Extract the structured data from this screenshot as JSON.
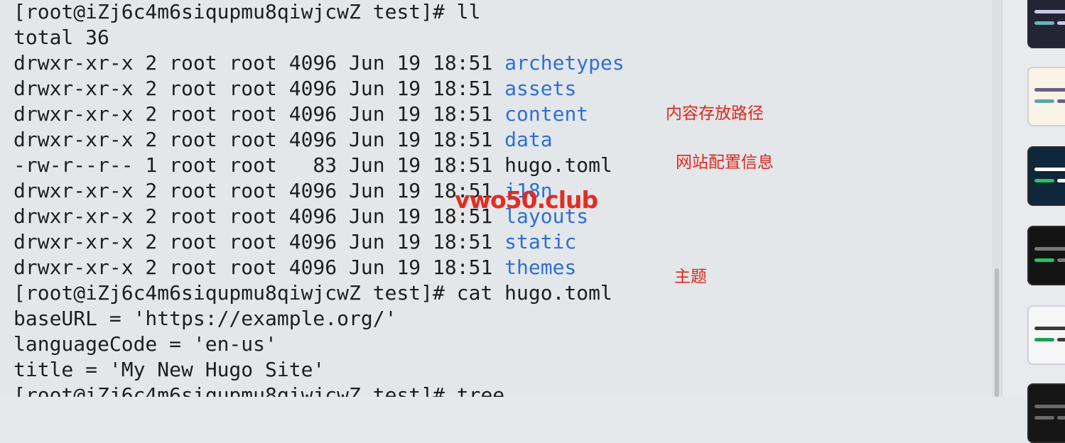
{
  "terminal": {
    "lines": [
      [
        {
          "t": "[root@iZj6c4m6siqupmu8qiwjcwZ test]# ll"
        }
      ],
      [
        {
          "t": "total 36"
        }
      ],
      [
        {
          "t": "drwxr-xr-x 2 root root 4096 Jun 19 18:51 "
        },
        {
          "t": "archetypes",
          "dir": true
        }
      ],
      [
        {
          "t": "drwxr-xr-x 2 root root 4096 Jun 19 18:51 "
        },
        {
          "t": "assets",
          "dir": true
        }
      ],
      [
        {
          "t": "drwxr-xr-x 2 root root 4096 Jun 19 18:51 "
        },
        {
          "t": "content",
          "dir": true
        }
      ],
      [
        {
          "t": "drwxr-xr-x 2 root root 4096 Jun 19 18:51 "
        },
        {
          "t": "data",
          "dir": true
        }
      ],
      [
        {
          "t": "-rw-r--r-- 1 root root   83 Jun 19 18:51 hugo.toml"
        }
      ],
      [
        {
          "t": "drwxr-xr-x 2 root root 4096 Jun 19 18:51 "
        },
        {
          "t": "i18n",
          "dir": true
        }
      ],
      [
        {
          "t": "drwxr-xr-x 2 root root 4096 Jun 19 18:51 "
        },
        {
          "t": "layouts",
          "dir": true
        }
      ],
      [
        {
          "t": "drwxr-xr-x 2 root root 4096 Jun 19 18:51 "
        },
        {
          "t": "static",
          "dir": true
        }
      ],
      [
        {
          "t": "drwxr-xr-x 2 root root 4096 Jun 19 18:51 "
        },
        {
          "t": "themes",
          "dir": true
        }
      ],
      [
        {
          "t": "[root@iZj6c4m6siqupmu8qiwjcwZ test]# cat hugo.toml"
        }
      ],
      [
        {
          "t": "baseURL = 'https://example.org/'"
        }
      ],
      [
        {
          "t": "languageCode = 'en-us'"
        }
      ],
      [
        {
          "t": "title = 'My New Hugo Site'"
        }
      ],
      [
        {
          "t": "[root@iZj6c4m6siqupmu8qiwjcwZ test]# tree"
        }
      ]
    ],
    "colors": {
      "background": "#e4e7ea",
      "text": "#1e1e1e",
      "directory": "#2f6fd6"
    }
  },
  "annotations": {
    "content_path": "内容存放路径",
    "site_config": "网站配置信息",
    "theme": "主题",
    "color": "#e0261c"
  },
  "watermark": {
    "text": "vwo50.club",
    "color": "#e32418"
  },
  "theme_panel": {
    "themes": [
      {
        "bg": "#242434",
        "bars": [
          "#cfc8e6",
          "#6ab6b2"
        ]
      },
      {
        "bg": "#f8f3e6",
        "bars": [
          "#6a5f8a",
          "#5aa8a6"
        ]
      },
      {
        "bg": "#10263a",
        "bars": [
          "#ffffff",
          "#22c55e"
        ]
      },
      {
        "bg": "#141414",
        "bars": [
          "#7a7a7a",
          "#22c55e"
        ]
      },
      {
        "bg": "#f6f6f6",
        "bars": [
          "#3a3a3a",
          "#16a34a"
        ]
      },
      {
        "bg": "#161616",
        "bars": [
          "#6a6a6a",
          "#6a6a6a"
        ]
      }
    ]
  }
}
